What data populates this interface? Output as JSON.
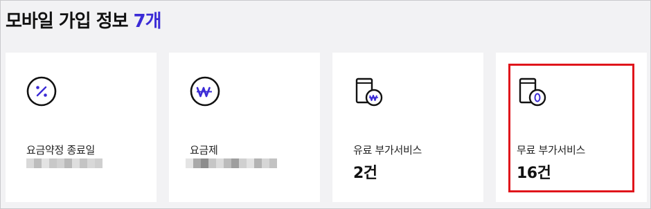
{
  "header": {
    "title": "모바일 가입 정보",
    "count": "7개"
  },
  "cards": [
    {
      "label": "요금약정 종료일",
      "value": "",
      "icon": "percent-circle-icon"
    },
    {
      "label": "요금제",
      "value": "",
      "icon": "won-circle-icon"
    },
    {
      "label": "유료 부가서비스",
      "value": "2건",
      "icon": "phone-won-icon"
    },
    {
      "label": "무료 부가서비스",
      "value": "16건",
      "icon": "phone-zero-icon"
    }
  ],
  "colors": {
    "accent": "#3b2bd6",
    "highlight": "#e0151b",
    "background": "#f2f2f4",
    "card": "#ffffff"
  }
}
